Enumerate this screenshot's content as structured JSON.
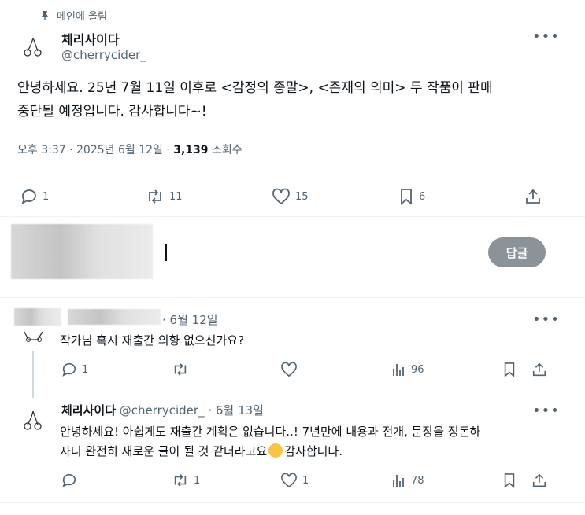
{
  "pinned": {
    "label": "메인에 올림"
  },
  "main_post": {
    "author_name": "체리사이다",
    "handle": "@cherrycider_",
    "text_line1": "안녕하세요. 25년 7월 11일 이후로 <감정의 종말>, <존재의 의미> 두 작품이 판매",
    "text_line2": "중단될 예정입니다. 감사합니다~!",
    "time_date": "오후 3:37 · 2025년 6월 12일 ·",
    "views_count": "3,139",
    "views_label": "조회수",
    "replies": "1",
    "reposts": "11",
    "likes": "15",
    "bookmarks": "6"
  },
  "composer": {
    "reply_button": "답글"
  },
  "reply1": {
    "date": "· 6월 12일",
    "text": "작가님 혹시 재출간 의향 없으신가요?",
    "replies": "1",
    "views": "96"
  },
  "reply2": {
    "author_name": "체리사이다",
    "handle": "@cherrycider_",
    "date": "· 6월 13일",
    "text_line1": "안녕하세요! 아쉽게도 재출간 계획은 없습니다..! 7년만에 내용과 전개, 문장을 정돈하",
    "text_line2a": "자니 완전히 새로운 글이 될 것 같더라고요",
    "text_line2b": "감사합니다.",
    "reposts": "1",
    "likes": "1",
    "views": "78"
  },
  "icons": [
    "pin-icon",
    "cherry-avatar-icon",
    "reply-icon",
    "repost-icon",
    "like-icon",
    "bookmark-icon",
    "share-icon",
    "views-icon",
    "more-icon",
    "crying-emoji-icon"
  ]
}
